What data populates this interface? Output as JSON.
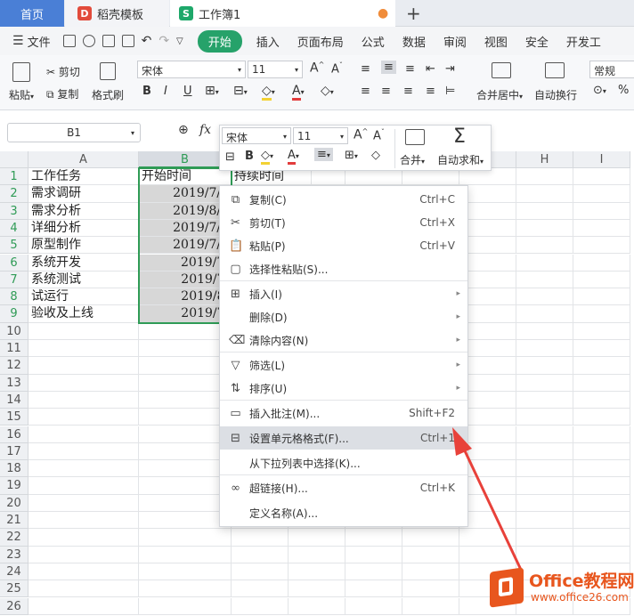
{
  "tabs": {
    "home": "首页",
    "template": "稻壳模板",
    "workbook": "工作簿1",
    "template_logo": "D",
    "workbook_logo": "S"
  },
  "menu": {
    "file": "文件",
    "items": [
      "开始",
      "插入",
      "页面布局",
      "公式",
      "数据",
      "审阅",
      "视图",
      "安全",
      "开发工"
    ]
  },
  "ribbon": {
    "paste": "粘贴",
    "cut": "剪切",
    "copy": "复制",
    "format_painter": "格式刷",
    "font": "宋体",
    "size": "11",
    "bold": "B",
    "italic": "I",
    "underline": "U",
    "merge": "合并居中",
    "wrap": "自动换行",
    "number_format": "常规",
    "percent": "%"
  },
  "formula_bar": {
    "name_box": "B1",
    "fx": "fx"
  },
  "mini_toolbar": {
    "font": "宋体",
    "size": "11",
    "bold": "B",
    "merge": "合并",
    "autosum": "自动求和"
  },
  "columns": [
    "A",
    "B",
    "C",
    "D",
    "E",
    "F",
    "G",
    "H",
    "I"
  ],
  "rows": [
    "1",
    "2",
    "3",
    "4",
    "5",
    "6",
    "7",
    "8",
    "9",
    "10",
    "11",
    "12",
    "13",
    "14",
    "15",
    "16",
    "17",
    "18",
    "19",
    "20",
    "21",
    "22",
    "23",
    "24",
    "25",
    "26"
  ],
  "cells": {
    "a": [
      "工作任务",
      "需求调研",
      "需求分析",
      "详细分析",
      "原型制作",
      "系统开发",
      "系统测试",
      "试运行",
      "验收及上线"
    ],
    "b": [
      "开始时间",
      "2019/7/1",
      "2019/8/1",
      "2019/7/1",
      "2019/7/1",
      "2019/7/",
      "2019/7.",
      "2019/8.",
      "2019/7."
    ],
    "c1": "持续时间"
  },
  "context_menu": {
    "items": [
      {
        "label": "复制(C)",
        "shortcut": "Ctrl+C",
        "icon": "copy-icon"
      },
      {
        "label": "剪切(T)",
        "shortcut": "Ctrl+X",
        "icon": "cut-icon"
      },
      {
        "label": "粘贴(P)",
        "shortcut": "Ctrl+V",
        "icon": "paste-icon"
      },
      {
        "label": "选择性粘贴(S)...",
        "shortcut": "",
        "icon": "paste-special-icon"
      },
      {
        "label": "插入(I)",
        "shortcut": "",
        "icon": "insert-icon"
      },
      {
        "label": "删除(D)",
        "shortcut": "",
        "icon": ""
      },
      {
        "label": "清除内容(N)",
        "shortcut": "",
        "icon": "eraser-icon"
      },
      {
        "label": "筛选(L)",
        "shortcut": "",
        "icon": "filter-icon"
      },
      {
        "label": "排序(U)",
        "shortcut": "",
        "icon": "sort-icon"
      },
      {
        "label": "插入批注(M)...",
        "shortcut": "Shift+F2",
        "icon": "comment-icon"
      },
      {
        "label": "设置单元格格式(F)...",
        "shortcut": "Ctrl+1",
        "icon": "format-cells-icon"
      },
      {
        "label": "从下拉列表中选择(K)...",
        "shortcut": "",
        "icon": ""
      },
      {
        "label": "超链接(H)...",
        "shortcut": "Ctrl+K",
        "icon": "link-icon"
      },
      {
        "label": "定义名称(A)...",
        "shortcut": "",
        "icon": ""
      }
    ]
  },
  "watermark": {
    "brand": "Office教程网",
    "url": "www.office26.com"
  },
  "colors": {
    "accent_green": "#26a26a",
    "arrow_red": "#e8413a",
    "brand_orange": "#e8561e"
  }
}
